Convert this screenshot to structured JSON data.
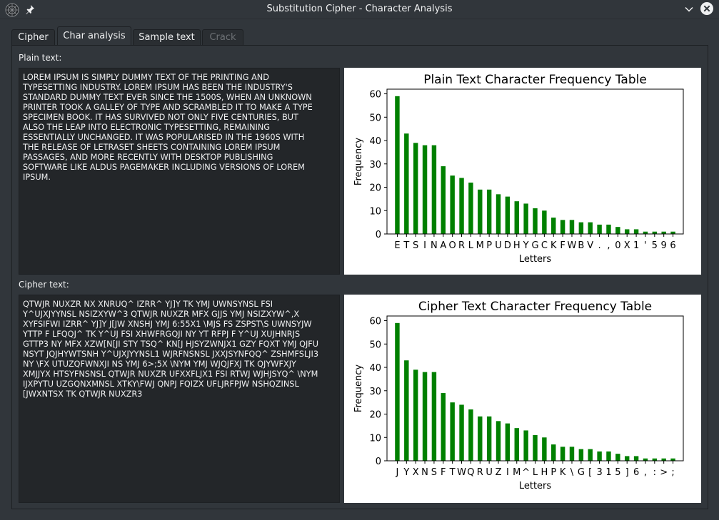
{
  "window": {
    "title": "Substitution Cipher - Character Analysis"
  },
  "tabs": [
    {
      "label": "Cipher",
      "active": false,
      "enabled": true
    },
    {
      "label": "Char analysis",
      "active": true,
      "enabled": true
    },
    {
      "label": "Sample text",
      "active": false,
      "enabled": true
    },
    {
      "label": "Crack",
      "active": false,
      "enabled": false
    }
  ],
  "plain": {
    "label": "Plain text:",
    "text": "LOREM IPSUM IS SIMPLY DUMMY TEXT OF THE PRINTING AND\nTYPESETTING INDUSTRY. LOREM IPSUM HAS BEEN THE INDUSTRY'S\nSTANDARD DUMMY TEXT EVER SINCE THE 1500S, WHEN AN UNKNOWN\nPRINTER TOOK A GALLEY OF TYPE AND SCRAMBLED IT TO MAKE A TYPE\nSPECIMEN BOOK. IT HAS SURVIVED NOT ONLY FIVE CENTURIES, BUT\nALSO THE LEAP INTO ELECTRONIC TYPESETTING, REMAINING\nESSENTIALLY UNCHANGED. IT WAS POPULARISED IN THE 1960S WITH\nTHE RELEASE OF LETRASET SHEETS CONTAINING LOREM IPSUM\nPASSAGES, AND MORE RECENTLY WITH DESKTOP PUBLISHING\nSOFTWARE LIKE ALDUS PAGEMAKER INCLUDING VERSIONS OF LOREM\nIPSUM."
  },
  "cipher": {
    "label": "Cipher text:",
    "text": "QTWJR NUXZR NX XNRUQ^ IZRR^ YJ]Y TK YMJ UWNSYNSL FSI\nY^UJXJYYNSL NSIZXYW^3 QTWJR NUXZR MFX GJJS YMJ NSIZXYW^,X\nXYFSIFWI IZRR^ YJ]Y J[JW XNSHJ YMJ 6:55X1 \\MJS FS ZSPST\\S UWNSYJW\nYTTP F LFQQJ^ TK Y^UJ FSI XHWFRGQJI NY YT RFPJ F Y^UJ XUJHNRJS\nGTTP3 NY MFX XZW[N[JI STY TSQ^ KN[J HJSYZWNJX1 GZY FQXT YMJ QJFU\nNSYT JQJHYWTSNH Y^UJXJYYNSL1 WJRFNSNSL JXXJSYNFQQ^ ZSHMFSLJI3\nNY \\FX UTUZQFWNXJI NS YMJ 6>;5X \\NYM YMJ WJQJFXJ TK QJYWFXJY\nXMJJYX HTSYFNSNSL QTWJR NUXZR UFXXFLJX1 FSI RTWJ WJHJSYQ^ \\NYM\nIJXPYTU UZGQNXMNSL XTKY\\FWJ QNPJ FQIZX UFLJRFPJW NSHQZINSL\n[JWXNTSX TK QTWJR NUXZR3"
  },
  "chart_data": [
    {
      "type": "bar",
      "title": "Plain Text Character Frequency Table",
      "xlabel": "Letters",
      "ylabel": "Frequency",
      "ylim": [
        0,
        62
      ],
      "yticks": [
        0,
        10,
        20,
        30,
        40,
        50,
        60
      ],
      "grid": false,
      "bar_color": "#008000",
      "categories": [
        "E",
        "T",
        "S",
        "I",
        "N",
        "A",
        "O",
        "R",
        "L",
        "M",
        "P",
        "U",
        "D",
        "H",
        "Y",
        "G",
        "C",
        "K",
        "F",
        "W",
        "B",
        "V",
        ".",
        ",",
        "0",
        "X",
        "1",
        "'",
        "5",
        "9",
        "6"
      ],
      "values": [
        59,
        43,
        39,
        38,
        38,
        29,
        25,
        24,
        22,
        19,
        19,
        17,
        16,
        14,
        13,
        11,
        10,
        7,
        6,
        6,
        5,
        5,
        4,
        4,
        3,
        2,
        2,
        1,
        1,
        1,
        1
      ]
    },
    {
      "type": "bar",
      "title": "Cipher Text Character Frequency Table",
      "xlabel": "Letters",
      "ylabel": "Frequency",
      "ylim": [
        0,
        62
      ],
      "yticks": [
        0,
        10,
        20,
        30,
        40,
        50,
        60
      ],
      "grid": false,
      "bar_color": "#008000",
      "categories": [
        "J",
        "Y",
        "X",
        "N",
        "S",
        "F",
        "T",
        "W",
        "Q",
        "R",
        "U",
        "Z",
        "I",
        "M",
        "^",
        "L",
        "H",
        "P",
        "K",
        "\\",
        "G",
        "[",
        "3",
        "1",
        "5",
        "]",
        "6",
        ",",
        ":",
        ">",
        ";"
      ],
      "values": [
        59,
        43,
        39,
        38,
        38,
        29,
        25,
        24,
        22,
        19,
        19,
        17,
        16,
        14,
        13,
        11,
        10,
        7,
        6,
        6,
        5,
        5,
        4,
        4,
        3,
        2,
        2,
        1,
        1,
        1,
        1
      ]
    }
  ]
}
